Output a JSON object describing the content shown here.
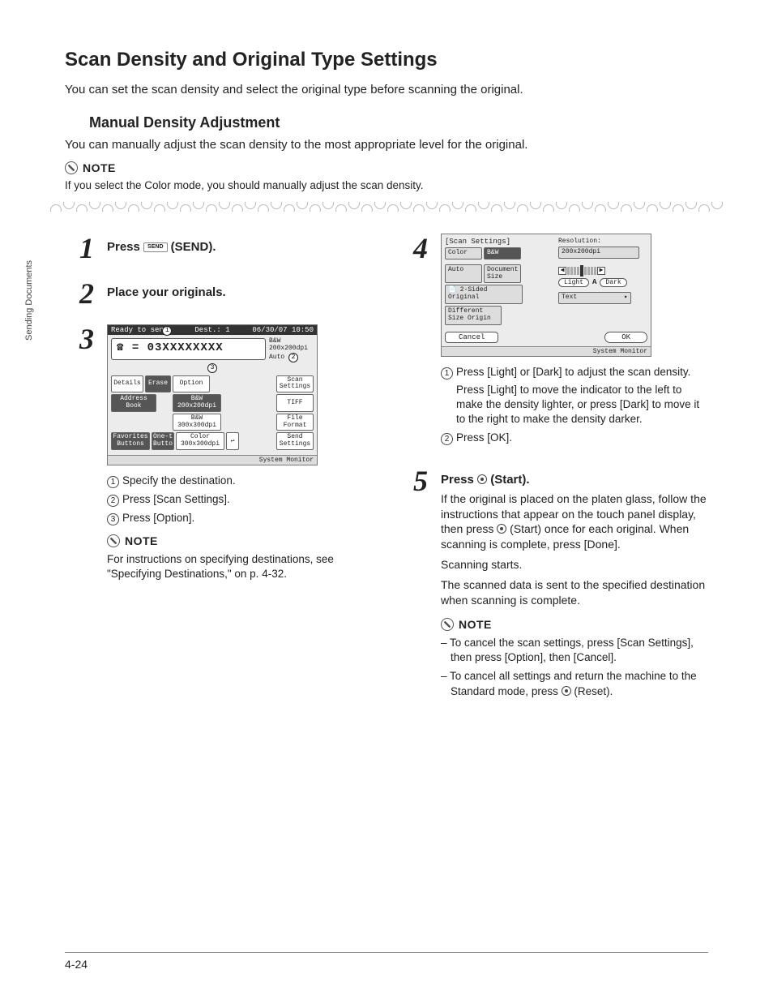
{
  "sidetab": "Sending Documents",
  "h1": "Scan Density and Original Type Settings",
  "intro": "You can set the scan density and select the original type before scanning the original.",
  "h2": "Manual Density Adjustment",
  "subintro": "You can manually adjust the scan density to the most appropriate level for the original.",
  "note_label": "NOTE",
  "top_note": "If you select the Color mode, you should manually adjust the scan density.",
  "steps": {
    "s1": {
      "num": "1",
      "title_a": "Press ",
      "title_key": "SEND",
      "title_b": " (SEND)."
    },
    "s2": {
      "num": "2",
      "title": "Place your originals."
    },
    "s3": {
      "num": "3",
      "sub1_n": "①",
      "sub1": "Specify the destination.",
      "sub2_n": "②",
      "sub2": "Press [Scan Settings].",
      "sub3_n": "③",
      "sub3": "Press [Option].",
      "note": "For instructions on specifying destinations, see \"Specifying Destinations,\" on p. 4-32."
    },
    "s4": {
      "num": "4",
      "sub1_n": "①",
      "sub1a": "Press [Light] or [Dark] to adjust the scan density.",
      "sub1b": "Press [Light] to move the indicator to the left to make the density lighter, or press [Dark] to move it to the right to make the density darker.",
      "sub2_n": "②",
      "sub2": "Press [OK]."
    },
    "s5": {
      "num": "5",
      "title": "Press ",
      "title_after": " (Start).",
      "p1": "If the original is placed on the platen glass, follow the instructions that appear on the touch panel display, then press ",
      "p1b": " (Start) once for each original. When scanning is complete, press [Done].",
      "p2": "Scanning starts.",
      "p3": "The scanned data is sent to the specified destination when scanning is complete.",
      "d1": "To cancel the scan settings, press [Scan Settings], then press [Option], then [Cancel].",
      "d2a": "To cancel all settings and return the machine to the Standard mode, press ",
      "d2b": " (Reset)."
    }
  },
  "lcd1": {
    "bar_l": "Ready to send.",
    "bar_m": "Dest.:  1",
    "bar_r": "06/30/07 10:50",
    "phone": "☎ = 03XXXXXXXX",
    "side_r1": "B&W",
    "side_r2": "200x200dpi",
    "side_r3": "Auto",
    "details": "Details",
    "erase": "Erase",
    "option": "Option",
    "scanset": "Scan\nSettings",
    "addr": "Address\nBook",
    "bw200": "B&W\n200x200dpi",
    "bw300": "B&W\n300x300dpi",
    "color": "Color\n300x300dpi",
    "tiff": "TIFF",
    "filefmt": "File\nFormat",
    "fav": "Favorites\nButtons",
    "onet": "One-t\nButto",
    "sendset": "Send\nSettings",
    "sysmon": "System Monitor"
  },
  "lcd2": {
    "title": "[Scan Settings]",
    "res_lbl": "Resolution:",
    "res_val": "200x200dpi",
    "color": "Color",
    "bw": "B&W",
    "auto": "Auto",
    "docsize": "Document\nSize",
    "twosided": "2-Sided\nOriginal",
    "diff": "Different\nSize Origin",
    "light": "Light",
    "mida": "A",
    "dark": "Dark",
    "text": "Text",
    "cancel": "Cancel",
    "ok": "OK",
    "sysmon": "System Monitor"
  },
  "pagefoot": "4-24"
}
